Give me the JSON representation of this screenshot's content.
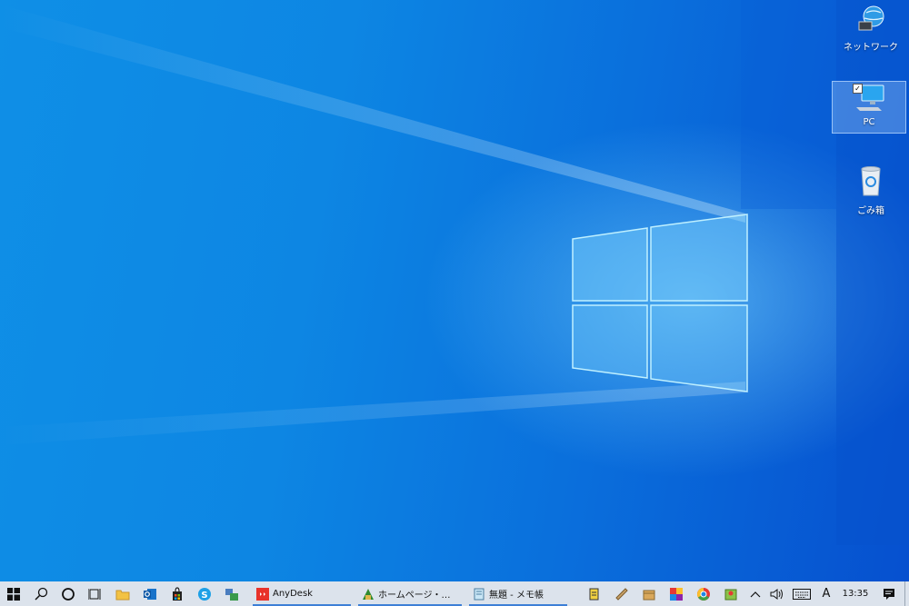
{
  "desktop": {
    "icons": [
      {
        "label": "ネットワーク"
      },
      {
        "label": "PC",
        "selected": true
      },
      {
        "label": "ごみ箱"
      }
    ]
  },
  "taskbar": {
    "apps": [
      {
        "label": "AnyDesk"
      },
      {
        "label": "ホームページ・ビルダー ..."
      },
      {
        "label": "無題 - メモ帳"
      }
    ],
    "ime": "A",
    "clock": "13:35"
  },
  "colors": {
    "taskbar_bg": "#dce3ec",
    "active_underline": "#3d7fd6",
    "desktop_blue": "#0d86e3"
  }
}
